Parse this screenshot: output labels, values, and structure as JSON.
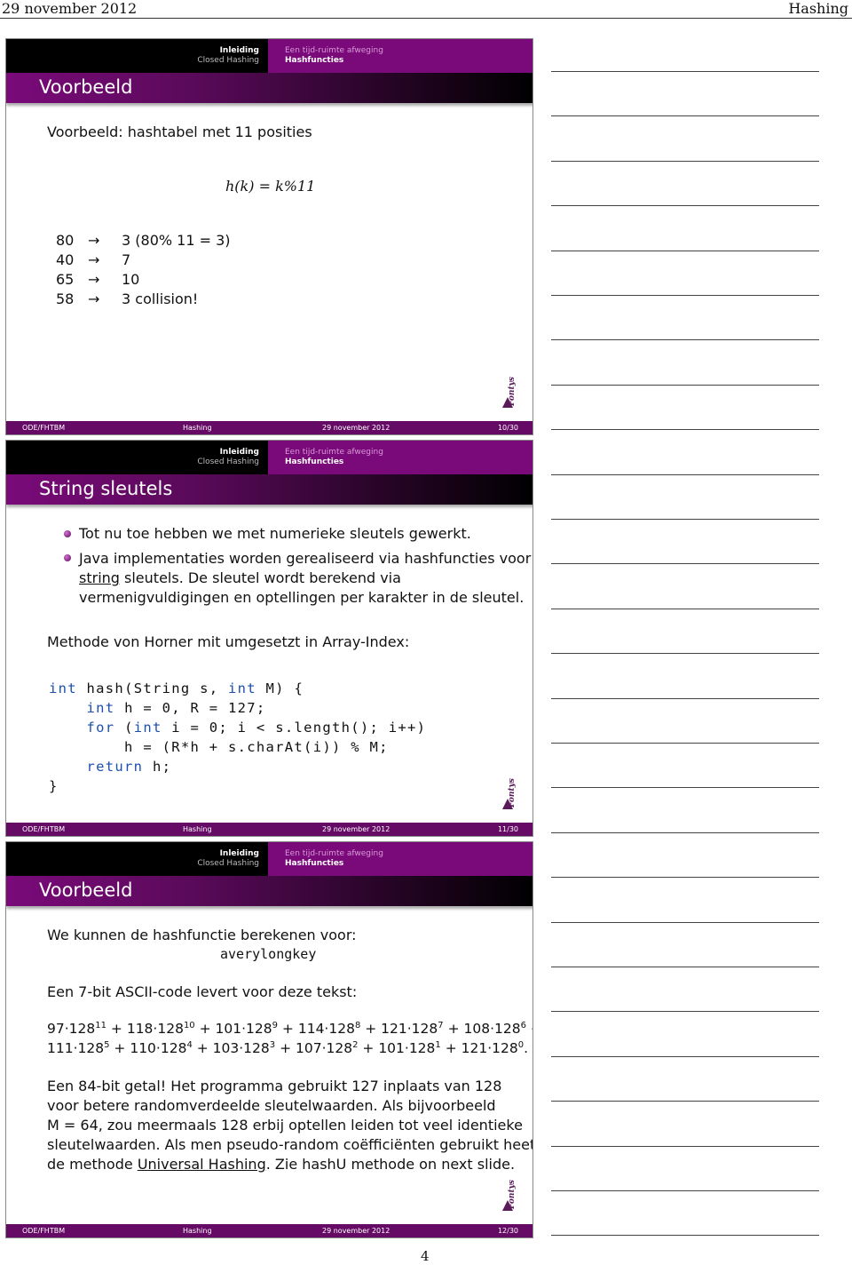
{
  "page": {
    "date": "29 november 2012",
    "title": "Hashing",
    "number": "4"
  },
  "nav": {
    "section1": "Inleiding",
    "section2": "Closed Hashing",
    "sub1": "Een tijd-ruimte afweging",
    "sub2": "Hashfuncties"
  },
  "footer": {
    "author": "ODE/FHTBM",
    "title": "Hashing",
    "date": "29 november 2012"
  },
  "logo": "Fontys",
  "slides": [
    {
      "title": "Voorbeeld",
      "page": "10/30",
      "intro": "Voorbeeld: hashtabel met 11 posities",
      "formula": "h(k) = k%11",
      "rows": [
        {
          "key": "80",
          "arrow": "→",
          "val": "3 (80% 11 = 3)"
        },
        {
          "key": "40",
          "arrow": "→",
          "val": "7"
        },
        {
          "key": "65",
          "arrow": "→",
          "val": "10"
        },
        {
          "key": "58",
          "arrow": "→",
          "val": "3 collision!"
        }
      ]
    },
    {
      "title": "String sleutels",
      "page": "11/30",
      "bullet1": "Tot nu toe hebben we met numerieke sleutels gewerkt.",
      "bullet2a": "Java implementaties worden gerealiseerd via hashfuncties voor",
      "bullet2b_link": "string",
      "bullet2b": " sleutels. De sleutel wordt berekend via",
      "bullet2c": "vermenigvuldigingen en optellingen per karakter in de sleutel.",
      "method": "Methode von Horner mit umgesetzt in Array-Index:",
      "code": {
        "l1a": "int",
        "l1b": " hash(String s, ",
        "l1c": "int",
        "l1d": " M) {",
        "l2a": "    int",
        "l2b": " h = 0, R = 127;",
        "l3a": "    for",
        "l3b": " (",
        "l3c": "int",
        "l3d": " i = 0; i < s.length(); i++)",
        "l4": "        h = (R*h + s.charAt(i)) % M;",
        "l5a": "    return",
        "l5b": " h;",
        "l6": "}"
      }
    },
    {
      "title": "Voorbeeld",
      "page": "12/30",
      "p1": "We kunnen de hashfunctie berekenen voor:",
      "word": "averylongkey",
      "p2": "Een 7-bit ASCII-code levert voor deze tekst:",
      "terms": [
        [
          "97",
          "11"
        ],
        [
          "118",
          "10"
        ],
        [
          "101",
          "9"
        ],
        [
          "114",
          "8"
        ],
        [
          "121",
          "7"
        ],
        [
          "108",
          "6"
        ],
        [
          "111",
          "5"
        ],
        [
          "110",
          "4"
        ],
        [
          "103",
          "3"
        ],
        [
          "107",
          "2"
        ],
        [
          "101",
          "1"
        ],
        [
          "121",
          "0"
        ]
      ],
      "base": "128",
      "t1": "Een 84-bit getal! Het programma gebruikt 127 inplaats van 128",
      "t2": "voor betere randomverdeelde sleutelwaarden. Als bijvoorbeeld",
      "t3": "M = 64, zou meermaals 128 erbij optellen leiden tot veel identieke",
      "t4": "sleutelwaarden. Als men pseudo-random coëfficiënten gebruikt heet",
      "t5a": "de methode ",
      "t5link": "Universal Hashing",
      "t5b": ". Zie hashU methode on next slide."
    }
  ]
}
